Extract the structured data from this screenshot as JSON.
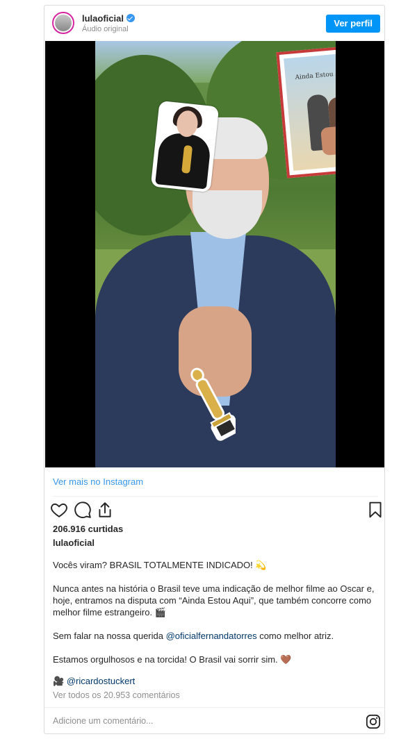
{
  "header": {
    "username": "lulaoficial",
    "audio": "Áudio original",
    "profile_button": "Ver perfil"
  },
  "media": {
    "poster_title": "Ainda Estou Aqui"
  },
  "links": {
    "view_more": "Ver mais no Instagram"
  },
  "actions": {
    "like_icon": "heart-icon",
    "comment_icon": "comment-icon",
    "share_icon": "share-icon",
    "save_icon": "bookmark-icon"
  },
  "post": {
    "likes": "206.916 curtidas",
    "username": "lulaoficial",
    "caption_1": "Vocês viram? BRASIL TOTALMENTE INDICADO! 💫",
    "caption_2": "Nunca antes na história o Brasil teve uma indicação de melhor filme ao Oscar e, hoje, entramos na disputa com “Ainda Estou Aqui”, que também concorre como melhor filme estrangeiro. 🎬",
    "caption_3a": "Sem falar na nossa querida ",
    "caption_3_mention": "@oficialfernandatorres",
    "caption_3b": " como melhor atriz.",
    "caption_4": "Estamos orgulhosos e na torcida! O Brasil vai sorrir sim. 🤎",
    "credit_emoji": "🎥",
    "credit": "@ricardostuckert",
    "view_all_comments": "Ver todos os 20.953 comentários"
  },
  "comment": {
    "placeholder": "Adicione um comentário..."
  },
  "colors": {
    "accent_blue": "#0095f6",
    "link_blue": "#3897f0"
  }
}
